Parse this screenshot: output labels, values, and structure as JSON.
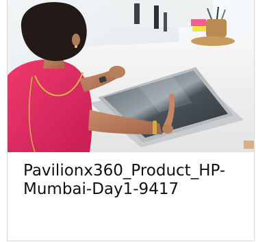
{
  "card": {
    "title": "Pavilionx360_Product_HP-Mumbai-Day1-9417",
    "image_alt": "Woman in pink top using a convertible laptop in tablet mode at a white desk",
    "image_subject": "photo-woman-using-convertible-laptop"
  },
  "colors": {
    "caption_text": "#111111",
    "card_border": "#d9d9d9",
    "top_pink": "#e0245e"
  }
}
